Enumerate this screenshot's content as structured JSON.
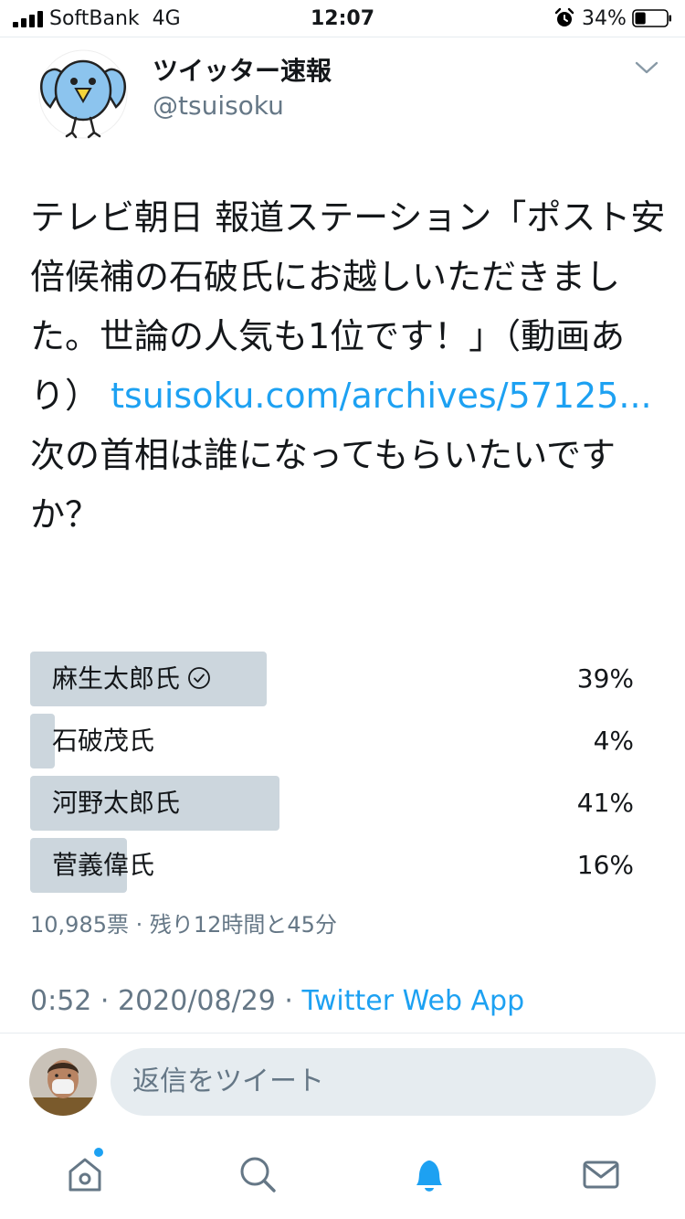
{
  "status_bar": {
    "carrier": "SoftBank",
    "network": "4G",
    "time": "12:07",
    "battery": "34%",
    "battery_level": 0.34
  },
  "author": {
    "name": "ツイッター速報",
    "handle": "@tsuisoku",
    "avatar_icon": "bird-icon"
  },
  "tweet": {
    "text_before_link": "テレビ朝日 報道ステーション「ポスト安倍候補の石破氏にお越しいただきました。世論の人気も1位です！」（動画あり） ",
    "link": "tsuisoku.com/archives/57125...",
    "text_after_link": " 次の首相は誰になってもらいたいですか？"
  },
  "poll": {
    "options": [
      {
        "label": "麻生太郎氏",
        "percent_text": "39%",
        "share": 0.39,
        "selected": true
      },
      {
        "label": "石破茂氏",
        "percent_text": "4%",
        "share": 0.04,
        "selected": false
      },
      {
        "label": "河野太郎氏",
        "percent_text": "41%",
        "share": 0.41,
        "selected": false
      },
      {
        "label": "菅義偉氏",
        "percent_text": "16%",
        "share": 0.16,
        "selected": false
      }
    ],
    "meta": "10,985票 · 残り12時間と45分"
  },
  "timestamp": {
    "time_date": "0:52 · 2020/08/29 · ",
    "source": "Twitter Web App"
  },
  "reply": {
    "placeholder": "返信をツイート"
  },
  "colors": {
    "accent": "#1da1f2",
    "poll_bar": "#ccd6dd",
    "secondary_text": "#657786"
  },
  "tabs": [
    {
      "name": "home",
      "icon": "home-icon",
      "has_notification_dot": true
    },
    {
      "name": "search",
      "icon": "search-icon"
    },
    {
      "name": "notifications",
      "icon": "bell-icon",
      "active": true
    },
    {
      "name": "messages",
      "icon": "envelope-icon"
    }
  ]
}
